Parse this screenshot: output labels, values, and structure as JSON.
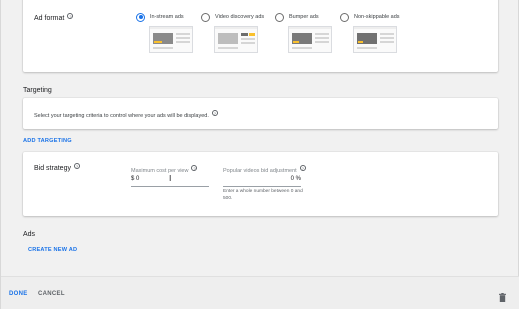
{
  "ad_format": {
    "title": "Ad format",
    "options": [
      {
        "label": "In-stream ads",
        "selected": true
      },
      {
        "label": "Video discovery ads",
        "selected": false
      },
      {
        "label": "Bumper ads",
        "selected": false
      },
      {
        "label": "Non-skippable ads",
        "selected": false
      }
    ]
  },
  "targeting": {
    "title": "Targeting",
    "description": "Select your targeting criteria to control where your ads will be displayed.",
    "add_label": "ADD TARGETING"
  },
  "bid_strategy": {
    "title": "Bid strategy",
    "max_cpv": {
      "label": "Maximum cost per view",
      "value": "$ 0"
    },
    "popular_videos": {
      "label": "Popular videos bid adjustment",
      "value": "0 %",
      "helper": "Enter a whole number between 0 and 500."
    }
  },
  "ads": {
    "title": "Ads",
    "create_label": "CREATE NEW AD"
  },
  "footer": {
    "done_label": "DONE",
    "cancel_label": "CANCEL"
  },
  "icons": {
    "help": "help-circle-icon",
    "trash": "trash-icon",
    "cursor": "text-cursor-icon"
  },
  "colors": {
    "accent": "#1a73e8",
    "background": "#f1f1f1",
    "card": "#ffffff"
  }
}
